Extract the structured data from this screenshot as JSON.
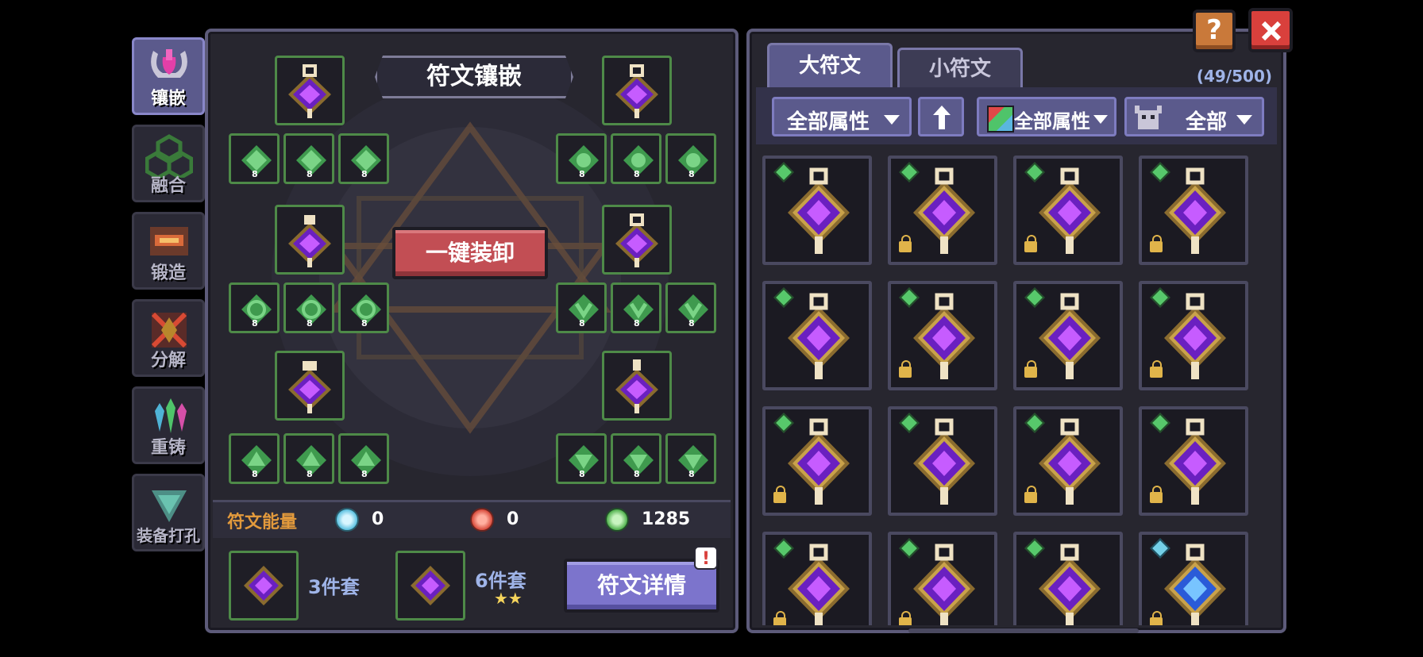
{
  "side_tabs": [
    {
      "label": "镶嵌",
      "icon": "vase-icon",
      "active": true
    },
    {
      "label": "融合",
      "icon": "hexagons-icon",
      "active": false
    },
    {
      "label": "锻造",
      "icon": "anvil-icon",
      "active": false
    },
    {
      "label": "分解",
      "icon": "broken-crystal-icon",
      "active": false
    },
    {
      "label": "重铸",
      "icon": "crystals-icon",
      "active": false
    },
    {
      "label": "装备打孔",
      "icon": "drill-icon",
      "active": false
    }
  ],
  "left_panel": {
    "title": "符文镶嵌",
    "unequip_all": "一键装卸",
    "small_slot_level": "8",
    "energy_label": "符文能量",
    "energy": [
      {
        "icon": "ice-orb-icon",
        "value": "0"
      },
      {
        "icon": "fire-orb-icon",
        "value": "0"
      },
      {
        "icon": "nature-orb-icon",
        "value": "1285"
      }
    ],
    "set_bonuses": [
      {
        "label": "3件套",
        "stars": ""
      },
      {
        "label": "6件套",
        "stars": "★★"
      }
    ],
    "details_button": "符文详情",
    "details_badge": "!"
  },
  "right_panel": {
    "tabs": [
      "大符文",
      "小符文"
    ],
    "active_tab": 0,
    "count": "(49/500)",
    "filters": {
      "attribute": "全部属性",
      "sort_icon": "arrow-up-icon",
      "color_attribute": "全部属性",
      "monster": "全部"
    },
    "grid": [
      {
        "gem": "green",
        "locked": false,
        "rune": "purple"
      },
      {
        "gem": "green",
        "locked": true,
        "rune": "purple"
      },
      {
        "gem": "green",
        "locked": true,
        "rune": "purple"
      },
      {
        "gem": "green",
        "locked": true,
        "rune": "purple"
      },
      {
        "gem": "green",
        "locked": false,
        "rune": "purple"
      },
      {
        "gem": "green",
        "locked": true,
        "rune": "purple"
      },
      {
        "gem": "green",
        "locked": true,
        "rune": "purple"
      },
      {
        "gem": "green",
        "locked": true,
        "rune": "purple"
      },
      {
        "gem": "green",
        "locked": true,
        "rune": "purple"
      },
      {
        "gem": "green",
        "locked": false,
        "rune": "purple"
      },
      {
        "gem": "green",
        "locked": true,
        "rune": "purple"
      },
      {
        "gem": "green",
        "locked": true,
        "rune": "purple"
      },
      {
        "gem": "green",
        "locked": true,
        "rune": "purple"
      },
      {
        "gem": "green",
        "locked": true,
        "rune": "purple"
      },
      {
        "gem": "green",
        "locked": false,
        "rune": "purple"
      },
      {
        "gem": "blue",
        "locked": true,
        "rune": "blue"
      }
    ]
  },
  "colors": {
    "panel_border": "#5d5b7a",
    "slot_border": "#4e8a48",
    "accent_orange": "#e39a3c",
    "button_red": "#c24e54",
    "button_purple": "#7c74cc",
    "close_red": "#d9403c",
    "help_orange": "#c9793a"
  }
}
